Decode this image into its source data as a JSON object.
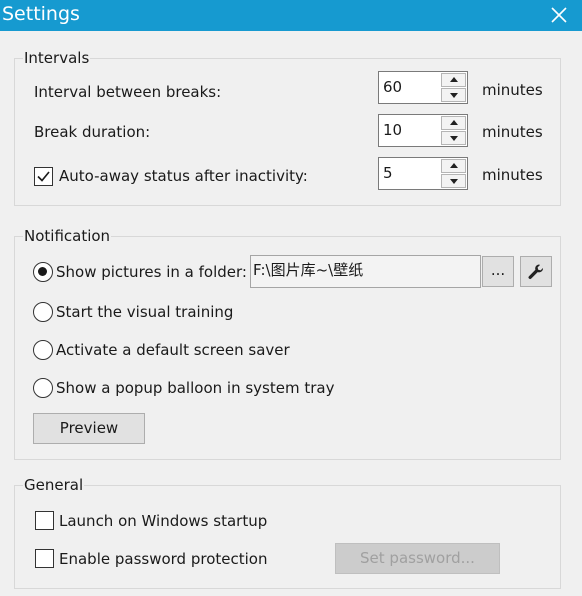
{
  "window": {
    "title": "Settings"
  },
  "intervals": {
    "label": "Intervals",
    "break_interval": {
      "label": "Interval between breaks:",
      "value": "60",
      "unit": "minutes"
    },
    "break_duration": {
      "label": "Break duration:",
      "value": "10",
      "unit": "minutes"
    },
    "auto_away": {
      "label": "Auto-away status after inactivity:",
      "value": "5",
      "unit": "minutes",
      "checked": true
    }
  },
  "notification": {
    "label": "Notification",
    "options": [
      {
        "label": "Show pictures in a folder:",
        "selected": true
      },
      {
        "label": "Start the visual training",
        "selected": false
      },
      {
        "label": "Activate a default screen saver",
        "selected": false
      },
      {
        "label": "Show a popup balloon in system tray",
        "selected": false
      }
    ],
    "folder_path": "F:\\图片库~\\壁纸",
    "browse_label": "...",
    "tools_icon": "wrench-icon",
    "preview_label": "Preview"
  },
  "general": {
    "label": "General",
    "launch_startup": {
      "label": "Launch on Windows startup",
      "checked": false
    },
    "password_protection": {
      "label": "Enable password protection",
      "checked": false
    },
    "set_password_label": "Set password..."
  }
}
